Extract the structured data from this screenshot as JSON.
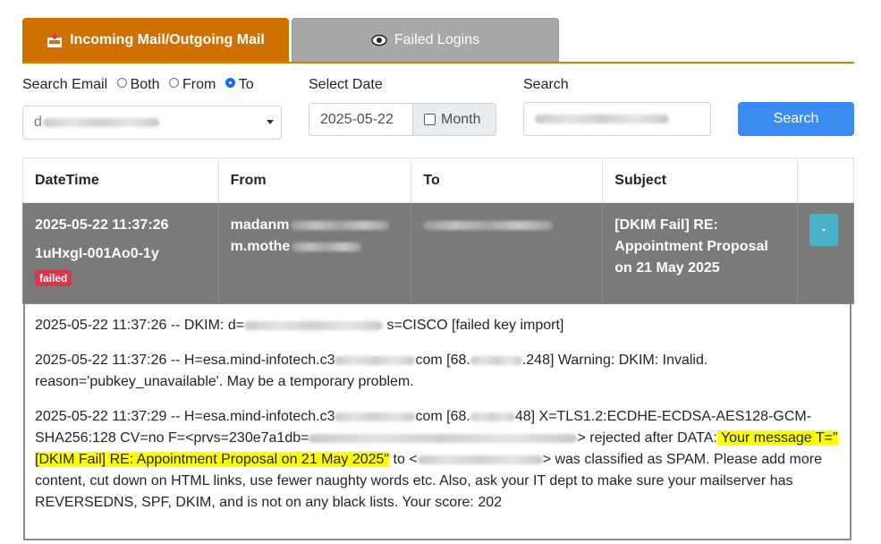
{
  "tabs": [
    {
      "label": "Incoming Mail/Outgoing Mail",
      "icon": "inbox-arrow-icon",
      "active": true
    },
    {
      "label": "Failed Logins",
      "icon": "eye-icon",
      "active": false
    }
  ],
  "filters": {
    "search_email_label": "Search Email",
    "radio_options": [
      "Both",
      "From",
      "To"
    ],
    "radio_selected": "To",
    "email_select_value_prefix": "d",
    "select_date_label": "Select Date",
    "date_value": "2025-05-22",
    "month_label": "Month",
    "search_label": "Search",
    "search_button": "Search"
  },
  "table": {
    "columns": [
      "DateTime",
      "From",
      "To",
      "Subject",
      ""
    ],
    "row": {
      "datetime": "2025-05-22 11:37:26",
      "message_id": "1uHxgI-001Ao0-1y",
      "status_badge": "failed",
      "from_line1": "madanm",
      "from_line2": "m.mothe",
      "subject": "[DKIM Fail] RE: Appointment Proposal on 21 May 2025",
      "toggle_label": "-"
    }
  },
  "details": {
    "line1_a": "2025-05-22 11:37:26 -- DKIM: d=",
    "line1_b": " s=CISCO [failed key import]",
    "line2_a": "2025-05-22 11:37:26 -- H=esa.mind-infotech.c3",
    "line2_b": "com [68.",
    "line2_c": ".248] Warning: DKIM: Invalid.",
    "line2_d": "reason='pubkey_unavailable'. May be a temporary problem.",
    "line3_a": "2025-05-22 11:37:29 -- H=esa.mind-infotech.c3",
    "line3_b": "com [68.",
    "line3_c": "48] X=TLS1.2:ECDHE-ECDSA-AES128-GCM-",
    "line3_d": "SHA256:128 CV=no F=<prvs=230e7a1db=",
    "line3_e": "> rejected after DATA:",
    "line3_hl1": " Your message T=\"",
    "line3_hl2": "[DKIM Fail] RE: Appointment Proposal on 21 May 2025\"",
    "line3_f": " to <",
    "line3_g": "> was classified as SPAM. Please add more",
    "line3_h": "content, cut down on HTML links, use fewer naughty words etc. Also, ask your IT dept to make sure your mailserver has",
    "line3_i": "REVERSEDNS, SPF, DKIM, and is not on any black lists. Your score: 202"
  },
  "colors": {
    "tab_active": "#d07000",
    "tab_inactive": "#a8a8a8",
    "search_button": "#3b8cf0",
    "failed_row": "#7a7a7a",
    "badge_failed": "#dc3545",
    "toggle_button": "#48b3c9",
    "highlight": "#ffff00"
  }
}
